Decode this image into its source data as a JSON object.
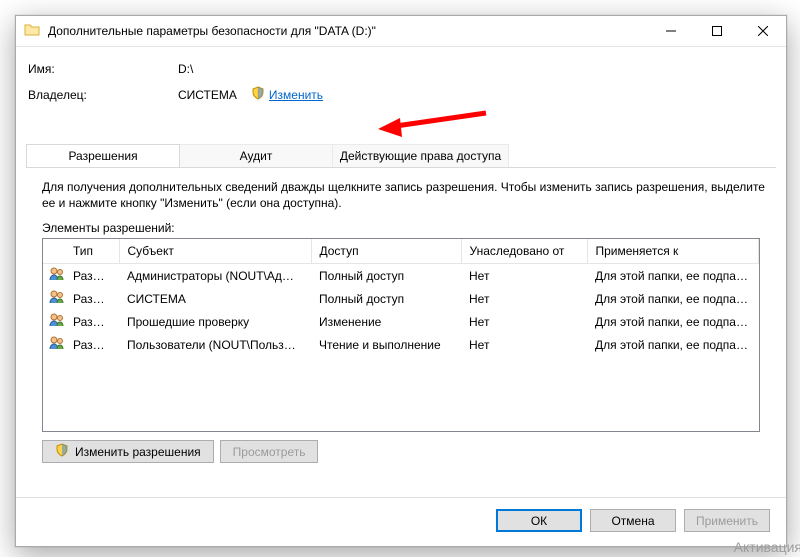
{
  "title": "Дополнительные параметры безопасности  для \"DATA (D:)\"",
  "name_label": "Имя:",
  "name_value": "D:\\",
  "owner_label": "Владелец:",
  "owner_value": "СИСТЕМА",
  "owner_change_link": "Изменить",
  "tabs": {
    "perm": "Разрешения",
    "audit": "Аудит",
    "effective": "Действующие права доступа"
  },
  "help_text": "Для получения дополнительных сведений дважды щелкните запись разрешения. Чтобы изменить запись разрешения, выделите ее и нажмите кнопку \"Изменить\" (если она доступна).",
  "perm_elements_label": "Элементы разрешений:",
  "columns": {
    "type": "Тип",
    "subject": "Субъект",
    "access": "Доступ",
    "inherited": "Унаследовано от",
    "applies": "Применяется к"
  },
  "rows": [
    {
      "type": "Разр…",
      "subject": "Администраторы (NOUT\\Ад…",
      "access": "Полный доступ",
      "inherited": "Нет",
      "applies": "Для этой папки, ее подпапок …"
    },
    {
      "type": "Разр…",
      "subject": "СИСТЕМА",
      "access": "Полный доступ",
      "inherited": "Нет",
      "applies": "Для этой папки, ее подпапок …"
    },
    {
      "type": "Разр…",
      "subject": "Прошедшие проверку",
      "access": "Изменение",
      "inherited": "Нет",
      "applies": "Для этой папки, ее подпапок …"
    },
    {
      "type": "Разр…",
      "subject": "Пользователи (NOUT\\Польз…",
      "access": "Чтение и выполнение",
      "inherited": "Нет",
      "applies": "Для этой папки, ее подпапок …"
    }
  ],
  "buttons": {
    "change_perm": "Изменить разрешения",
    "view": "Просмотреть",
    "ok": "ОК",
    "cancel": "Отмена",
    "apply": "Применить"
  },
  "watermark": "Активация"
}
